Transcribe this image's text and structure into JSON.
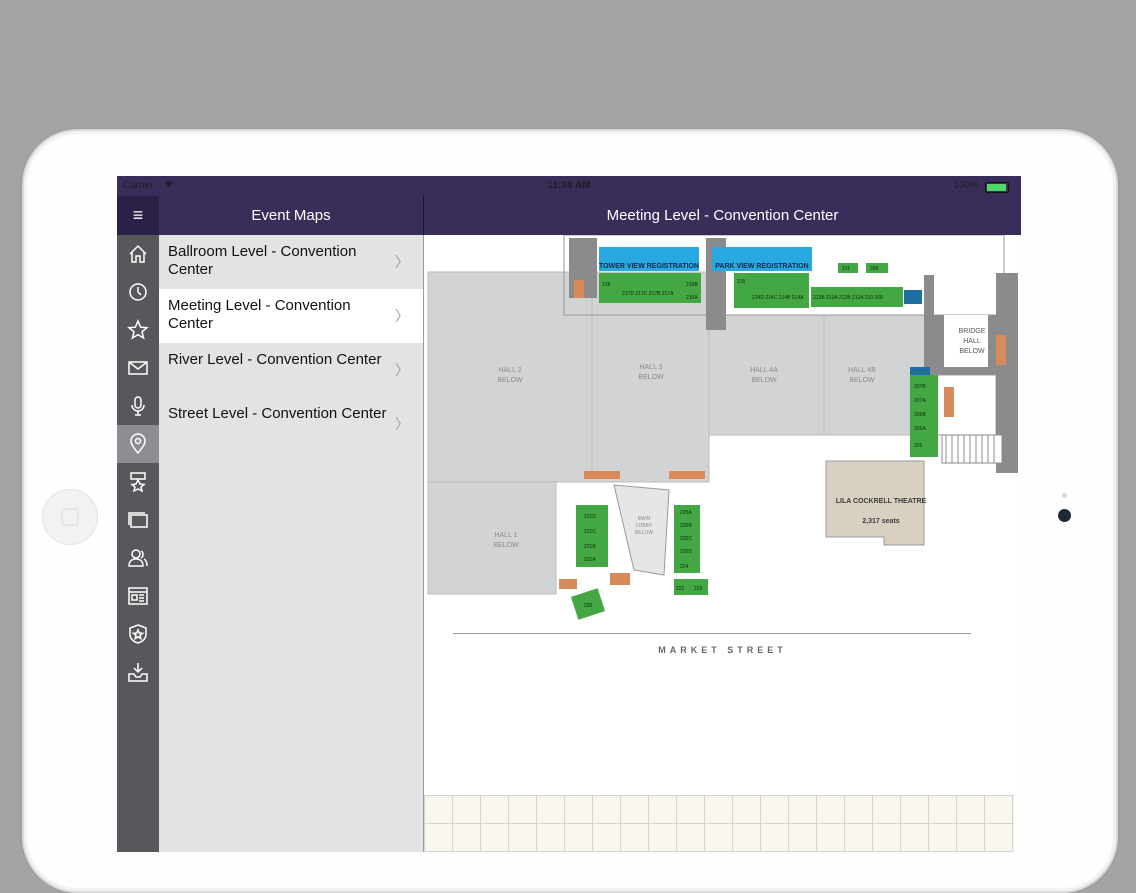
{
  "status_bar": {
    "carrier": "Carrier",
    "time": "11:38 AM",
    "battery": "100%"
  },
  "nav": {
    "menu_icon": "hamburger-icon",
    "left_title": "Event Maps",
    "main_title": "Meeting Level - Convention Center"
  },
  "sidebar_icons": [
    {
      "name": "home-icon",
      "active": false
    },
    {
      "name": "clock-icon",
      "active": false
    },
    {
      "name": "star-icon",
      "active": false
    },
    {
      "name": "envelope-icon",
      "active": false
    },
    {
      "name": "microphone-icon",
      "active": false
    },
    {
      "name": "map-pin-icon",
      "active": true
    },
    {
      "name": "award-badge-icon",
      "active": false
    },
    {
      "name": "windows-icon",
      "active": false
    },
    {
      "name": "people-icon",
      "active": false
    },
    {
      "name": "newspaper-icon",
      "active": false
    },
    {
      "name": "shield-star-icon",
      "active": false
    },
    {
      "name": "download-tray-icon",
      "active": false
    }
  ],
  "maps": [
    {
      "label": "Ballroom Level - Convention Center",
      "selected": false
    },
    {
      "label": "Meeting Level - Convention Center",
      "selected": true
    },
    {
      "label": "River Level - Convention Center",
      "selected": false
    },
    {
      "label": "Street Level - Convention Center",
      "selected": false
    }
  ],
  "floorplan": {
    "halls": {
      "hall2": "HALL 2 BELOW",
      "hall3": "HALL 3 BELOW",
      "hall4a": "HALL 4A BELOW",
      "hall4b": "HALL 4B BELOW",
      "hall1": "HALL 1 BELOW",
      "bridge": "BRIDGE HALL BELOW",
      "main_lobby": "MAIN LOBBY BELOW"
    },
    "registration": {
      "tower": "TOWER VIEW REGISTRATION",
      "park": "PARK VIEW REGISTRATION"
    },
    "theatre": {
      "name": "LILA COCKRELL THEATRE",
      "seats": "2,317 seats"
    },
    "rooms_top": [
      "218",
      "217D",
      "217C",
      "217B",
      "217A",
      "216B",
      "216A",
      "215",
      "214D",
      "214C",
      "214B",
      "214A",
      "213B",
      "213A",
      "212B",
      "212A",
      "210",
      "208",
      "211",
      "209"
    ],
    "rooms_right": [
      "207B",
      "207A",
      "206B",
      "206A",
      "205"
    ],
    "rooms_left_stack": [
      "221D",
      "221C",
      "221B",
      "221A"
    ],
    "rooms_right_stack": [
      "225A",
      "225B",
      "225C",
      "225D",
      "224"
    ],
    "rooms_bottom": [
      "222",
      "223",
      "220"
    ],
    "street": "MARKET STREET",
    "colors": {
      "room_green": "#43a843",
      "registration_blue": "#29a7e1",
      "hall_gray": "#d2d3d5",
      "wall_gray": "#8b8b8e",
      "accent_orange": "#d98a5a",
      "theatre_tan": "#d8d1c2"
    }
  }
}
